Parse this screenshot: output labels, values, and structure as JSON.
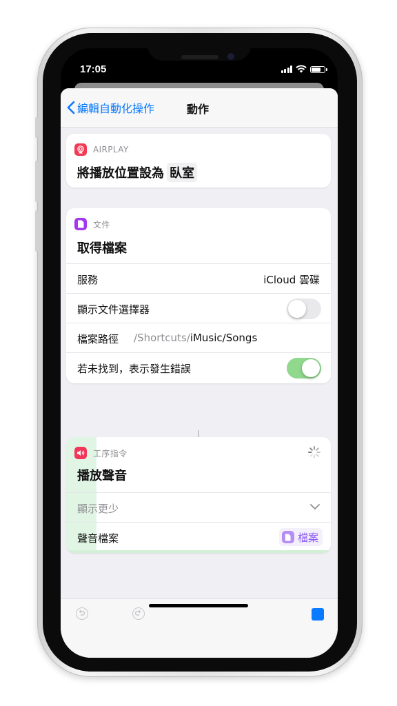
{
  "status": {
    "time": "17:05"
  },
  "nav": {
    "back_label": "編輯自動化操作",
    "title": "動作"
  },
  "actions": [
    {
      "app": "AIRPLAY",
      "title": "將播放位置設為",
      "token": "臥室",
      "icon_color": "#f23a55"
    },
    {
      "app": "文件",
      "title": "取得檔案",
      "icon_color": "#a238f0",
      "rows": {
        "service_label": "服務",
        "service_value": "iCloud 雲碟",
        "picker_label": "顯示文件選擇器",
        "picker_on": false,
        "path_label": "檔案路徑",
        "path_prefix": "/Shortcuts/",
        "path_value": "iMusic/Songs",
        "error_label": "若未找到，表示發生錯誤",
        "error_on": true
      }
    },
    {
      "app": "工序指令",
      "title": "播放聲音",
      "icon_color": "#f2375a",
      "rows": {
        "show_less": "顯示更少",
        "sound_label": "聲音檔案",
        "sound_value": "檔案"
      }
    }
  ],
  "toolbar": {
    "undo": "undo-icon",
    "redo": "redo-icon",
    "run": "stop-icon"
  },
  "colors": {
    "accent": "#0a7aff",
    "toggle_on": "#8fd88c",
    "variable": "#8e5cf6"
  }
}
